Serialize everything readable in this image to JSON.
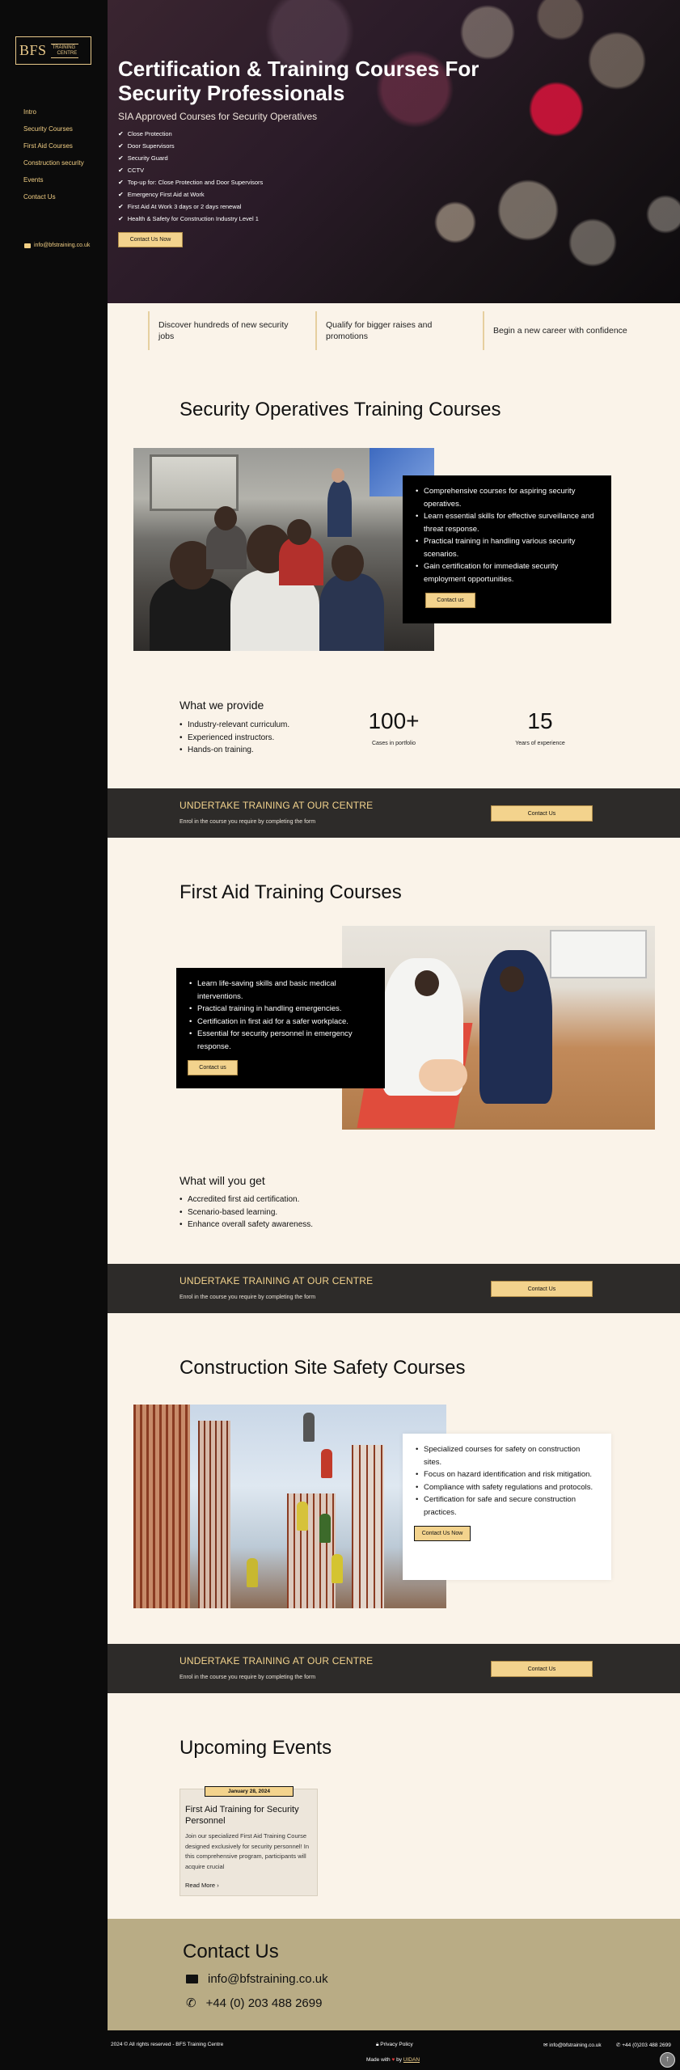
{
  "brand": {
    "main": "BFS",
    "sub_line1": "TRAINING",
    "sub_line2": "CENTRE"
  },
  "sidebar": {
    "nav": [
      "Intro",
      "Security Courses",
      "First Aid Courses",
      "Construction security",
      "Events",
      "Contact Us"
    ],
    "email": "info@bfstraining.co.uk"
  },
  "hero": {
    "title": "Certification & Training Courses For Security Professionals",
    "subtitle": "SIA Approved Courses for Security Operatives",
    "checklist": [
      "Close Protection",
      "Door Supervisors",
      "Security Guard",
      "CCTV",
      "Top-up for: Close Protection and Door Supervisors",
      "Emergency First Aid at Work",
      "First Aid At Work 3 days or 2 days renewal",
      "Health & Safety for Construction Industry Level 1"
    ],
    "button": "Contact Us Now"
  },
  "features": [
    "Discover hundreds of new security jobs",
    "Qualify for bigger raises and promotions",
    "Begin a new career with confidence"
  ],
  "security": {
    "title": "Security Operatives Training Courses",
    "bullets": [
      "Comprehensive courses for aspiring security operatives.",
      "Learn essential skills for effective surveillance and threat response.",
      "Practical training in handling various security scenarios.",
      "Gain certification for immediate security employment opportunities."
    ],
    "button": "Contact us",
    "provide_title": "What we provide",
    "provide_list": [
      "Industry-relevant curriculum.",
      "Experienced instructors.",
      "Hands-on training."
    ],
    "stats": [
      {
        "num": "100+",
        "label": "Cases in portfolio"
      },
      {
        "num": "15",
        "label": "Years of experience"
      }
    ]
  },
  "cta": {
    "title": "UNDERTAKE TRAINING AT OUR CENTRE",
    "subtitle": "Enrol in the course you require by completing the form",
    "button": "Contact Us"
  },
  "firstaid": {
    "title": "First Aid Training Courses",
    "bullets": [
      "Learn life-saving skills and basic medical interventions.",
      "Practical training in handling emergencies.",
      "Certification in first aid for a safer workplace.",
      "Essential for security personnel in emergency response."
    ],
    "button": "Contact us",
    "get_title": "What will you get",
    "get_list": [
      "Accredited first aid certification.",
      "Scenario-based learning.",
      "Enhance overall safety awareness."
    ]
  },
  "construction": {
    "title": "Construction Site Safety Courses",
    "bullets": [
      "Specialized courses for safety on construction sites.",
      "Focus on hazard identification and risk mitigation.",
      "Compliance with safety regulations and protocols.",
      "Certification for safe and secure construction practices."
    ],
    "button": "Contact Us Now"
  },
  "events": {
    "title": "Upcoming Events",
    "items": [
      {
        "date": "January 28, 2024",
        "title": "First Aid Training for Security Personnel",
        "desc": "Join our specialized First Aid Training Course designed exclusively for security personnel! In this comprehensive program, participants will acquire crucial",
        "more": "Read More"
      }
    ]
  },
  "contact": {
    "title": "Contact Us",
    "email": "info@bfstraining.co.uk",
    "phone": "+44 (0) 203 488 2699"
  },
  "footer": {
    "copyright": "2024 © All rights reserved - BFS Training Centre",
    "privacy": "Privacy Policy",
    "email": "info@bfstraining.co.uk",
    "phone": "+44 (0)203 488 2699",
    "made_with": "Made with",
    "made_by_prefix": "by",
    "made_by": "UIDAN"
  },
  "colors": {
    "accent": "#f3d38d",
    "dark": "#0b0b0b",
    "cream": "#faf3e9",
    "band": "#2d2b29",
    "contact_bg": "#b9ac85"
  }
}
